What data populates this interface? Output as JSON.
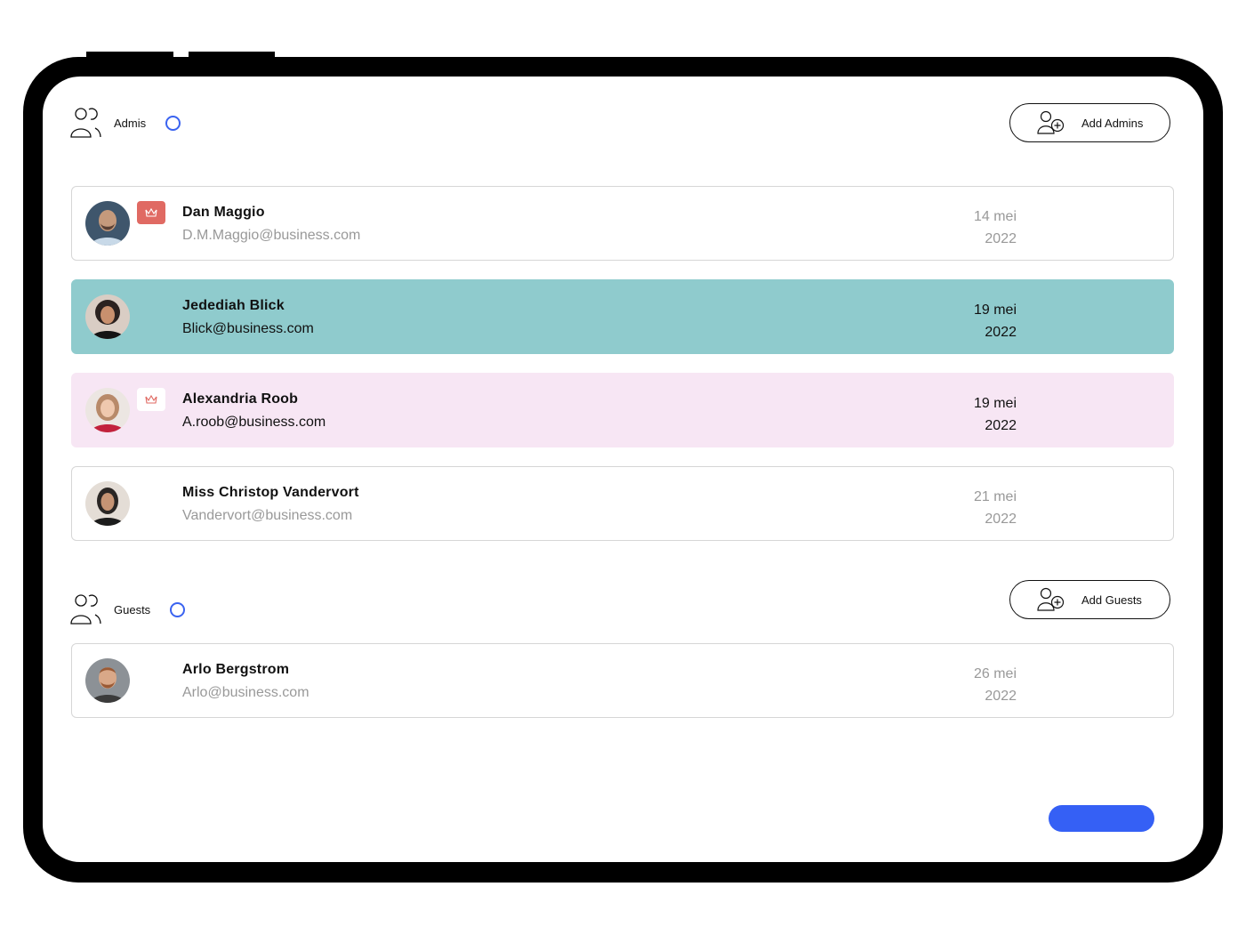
{
  "colors": {
    "accent": "#3560f5",
    "ring": "#3a63f0",
    "highlight_row": "#8fcbcd",
    "soft_row": "#f7e6f4",
    "crown_badge": "#e06a63"
  },
  "admins": {
    "label": "Admis",
    "add_label": "Add Admins",
    "rows": [
      {
        "name": "Dan Maggio",
        "email": "D.M.Maggio@business.com",
        "date_day": "14 mei",
        "date_year": "2022",
        "badge": "crown-icon"
      },
      {
        "name": "Jedediah Blick",
        "email": "Blick@business.com",
        "date_day": "19 mei",
        "date_year": "2022"
      },
      {
        "name": "Alexandria Roob",
        "email": "A.roob@business.com",
        "date_day": "19 mei",
        "date_year": "2022",
        "badge": "crown-icon"
      },
      {
        "name": "Miss Christop Vandervort",
        "email": "Vandervort@business.com",
        "date_day": "21 mei",
        "date_year": "2022"
      }
    ]
  },
  "guests": {
    "label": "Guests",
    "add_label": "Add Guests",
    "rows": [
      {
        "name": "Arlo Bergstrom",
        "email": "Arlo@business.com",
        "date_day": "26 mei",
        "date_year": "2022"
      }
    ]
  }
}
